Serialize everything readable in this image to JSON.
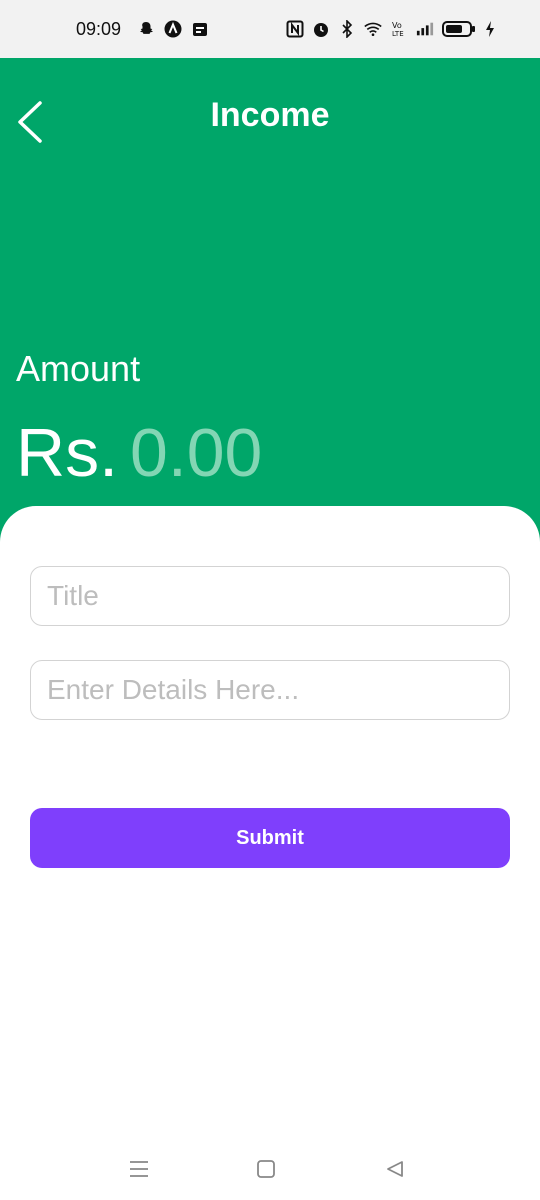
{
  "status_bar": {
    "time": "09:09",
    "left_icons": [
      "snapchat-icon",
      "arc-icon",
      "calendar-icon"
    ],
    "right_icons": [
      "nfc-icon",
      "alarm-icon",
      "bluetooth-icon",
      "wifi-icon",
      "volte-icon",
      "signal-icon",
      "battery-icon",
      "charging-icon"
    ]
  },
  "header": {
    "title": "Income",
    "back_icon": "chevron-left-icon",
    "amount_label": "Amount",
    "currency": "Rs.",
    "amount_placeholder": "0.00"
  },
  "form": {
    "title_placeholder": "Title",
    "details_placeholder": "Enter Details Here...",
    "submit_label": "Submit"
  },
  "navbar": {
    "icons": [
      "menu-icon",
      "home-icon",
      "back-icon"
    ]
  },
  "colors": {
    "header_green": "#00a669",
    "accent_purple": "#7f3ffc",
    "amount_placeholder": "#83d6b4"
  }
}
